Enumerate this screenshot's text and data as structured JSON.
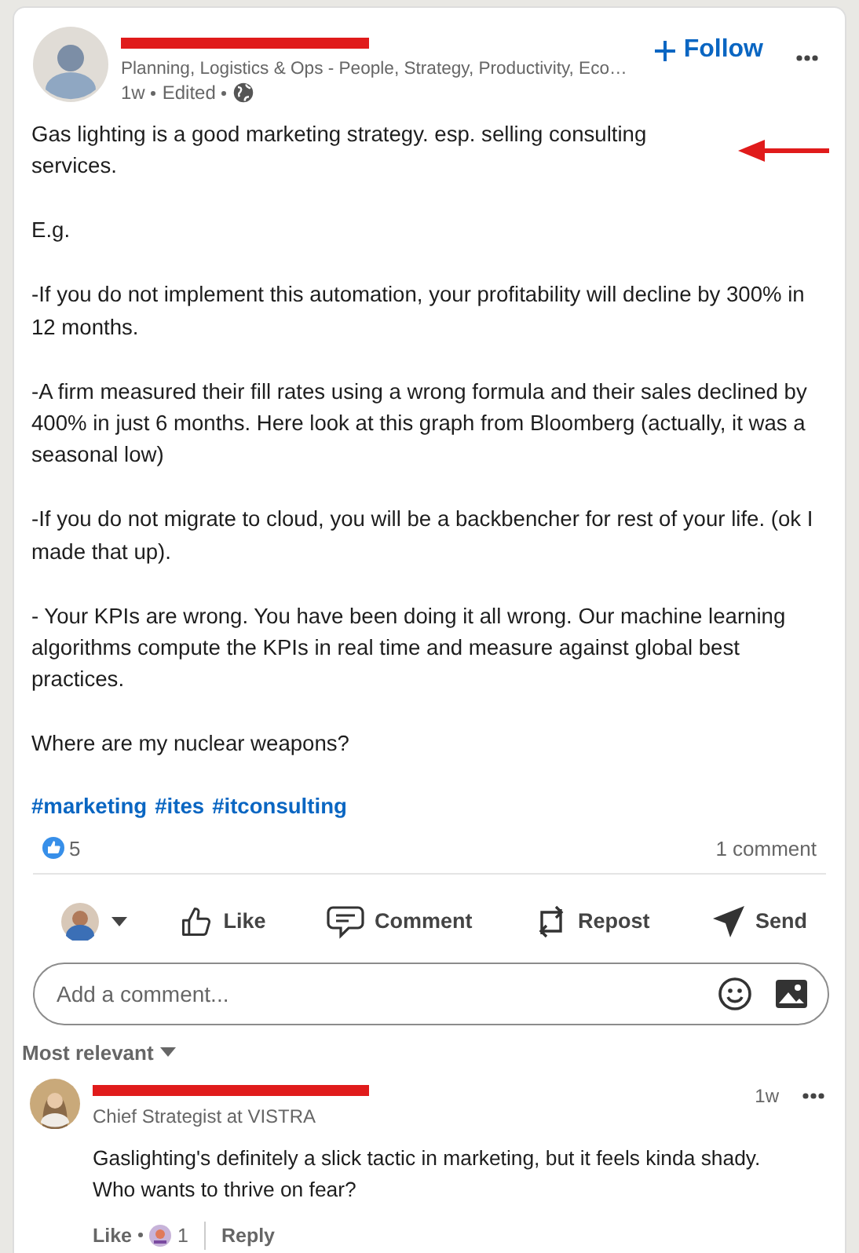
{
  "post": {
    "author": {
      "redacted": true
    },
    "headline": "Planning, Logistics & Ops - People, Strategy, Productivity, Eco…",
    "time": "1w",
    "edited": "Edited",
    "follow": "Follow",
    "annotation": {
      "kind": "arrow"
    },
    "paragraphs": [
      "Gas lighting is a good marketing strategy. esp. selling consulting services.",
      "E.g.",
      "-If you do not implement this automation, your profitability will decline by 300% in 12 months.",
      "-A firm measured their fill rates using a wrong formula and their sales declined by 400% in just 6 months. Here look at this graph from Bloomberg (actually, it was a seasonal low)",
      "-If you do not migrate to cloud, you will be a backbencher for rest of your life. (ok I made that up).",
      "- Your KPIs are wrong. You have been doing it all wrong. Our machine learning algorithms compute the KPIs in real time and measure against global best practices.",
      "Where are my nuclear weapons?"
    ],
    "hashtags": [
      "#marketing",
      "#ites",
      "#itconsulting"
    ],
    "reactions": "5",
    "comments_count": "1 comment"
  },
  "actions": [
    {
      "kind": "like",
      "label": "Like"
    },
    {
      "kind": "comment",
      "label": "Comment"
    },
    {
      "kind": "repost",
      "label": "Repost"
    },
    {
      "kind": "send",
      "label": "Send"
    }
  ],
  "comment_box": {
    "placeholder": "Add a comment..."
  },
  "sort": "Most relevant",
  "comments": [
    {
      "author": {
        "redacted": true
      },
      "headline": "Chief Strategist at VISTRA",
      "time": "1w",
      "text": "Gaslighting's definitely a slick tactic in marketing, but it feels kinda shady. Who wants to thrive on fear?",
      "like": "Like",
      "reactions": "1",
      "reply": "Reply"
    }
  ]
}
